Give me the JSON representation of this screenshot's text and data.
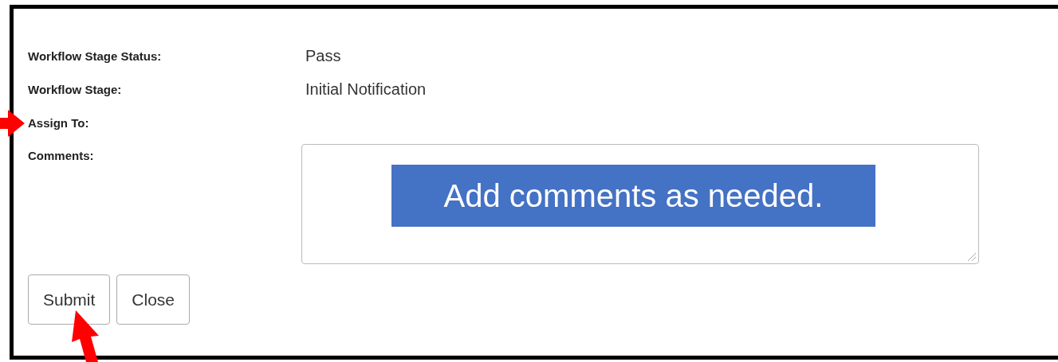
{
  "fields": [
    {
      "label": "Workflow Stage Status:",
      "value": "Pass"
    },
    {
      "label": "Workflow Stage:",
      "value": "Initial Notification"
    },
    {
      "label": "Assign To:"
    }
  ],
  "comments": {
    "label": "Comments:"
  },
  "buttons": [
    "Submit",
    "Close"
  ],
  "callout": "Add comments as needed."
}
